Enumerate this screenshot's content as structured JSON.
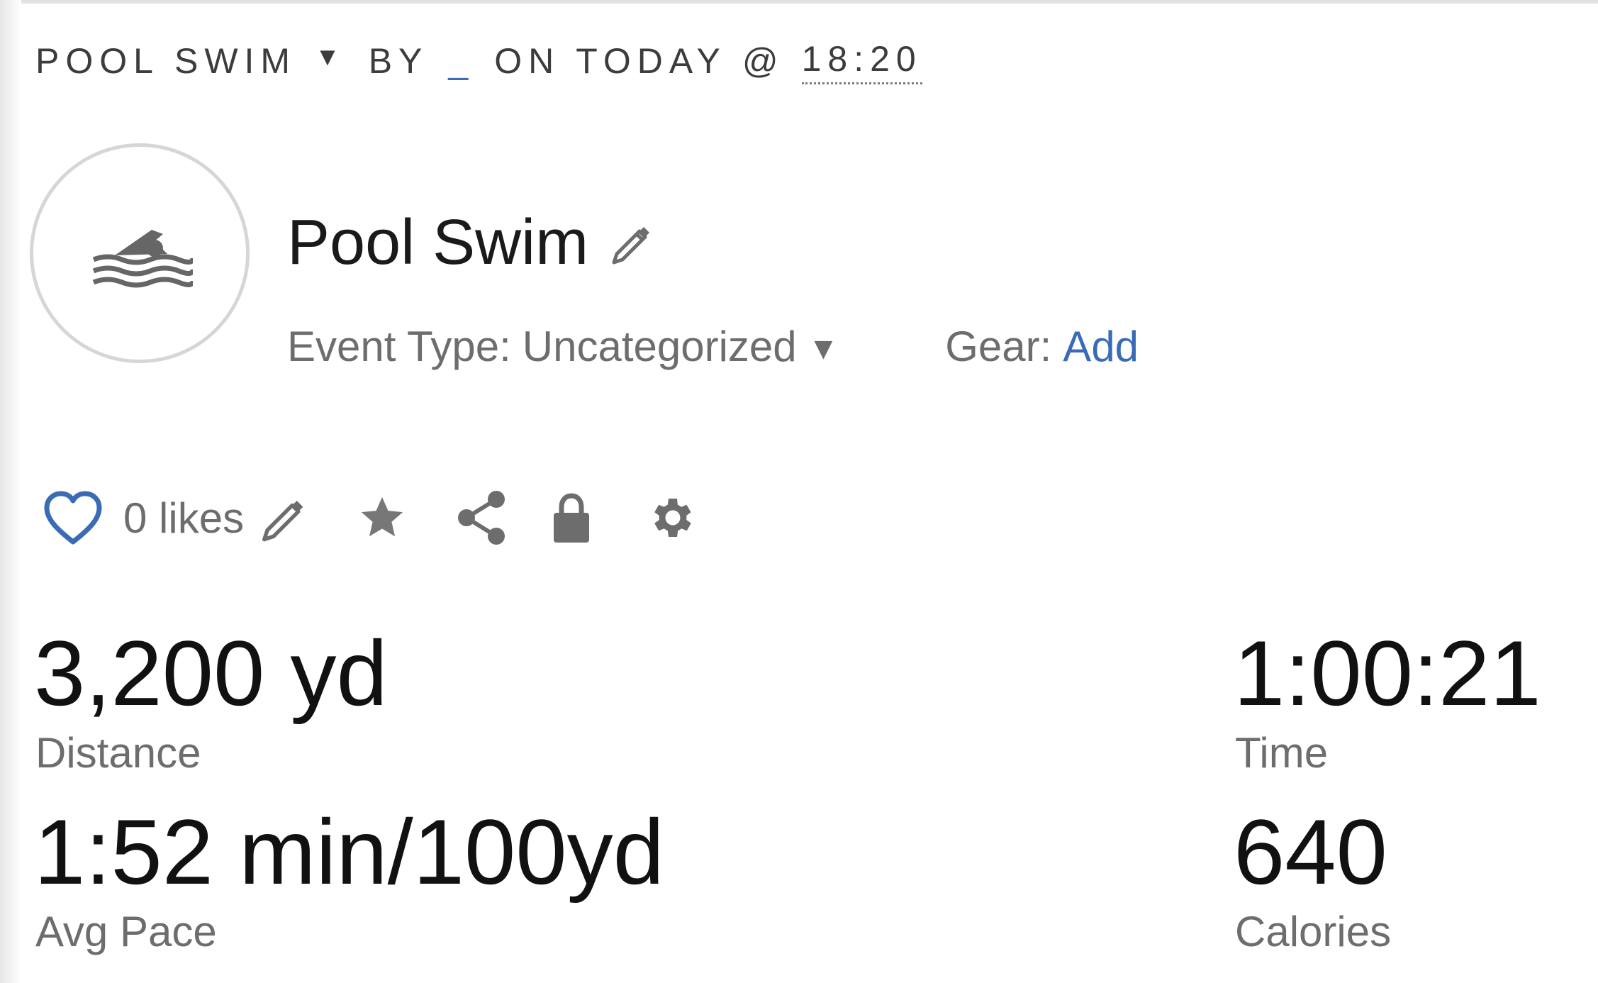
{
  "header": {
    "activity_type": "POOL SWIM",
    "caret": "▼",
    "by": "BY",
    "owner": "_",
    "on": "ON TODAY @",
    "time": "18:20"
  },
  "activity": {
    "icon": "swimmer-icon",
    "title": "Pool Swim",
    "event_type_label": "Event Type:",
    "event_type_value": "Uncategorized",
    "event_type_caret": "▼",
    "gear_label": "Gear:",
    "gear_add": "Add"
  },
  "actions": {
    "likes_text": "0 likes",
    "icons": [
      "heart-icon",
      "pencil-icon",
      "star-icon",
      "share-icon",
      "lock-icon",
      "gear-icon"
    ]
  },
  "stats": {
    "distance": {
      "value": "3,200 yd",
      "label": "Distance"
    },
    "time": {
      "value": "1:00:21",
      "label": "Time"
    },
    "avg_pace": {
      "value": "1:52 min/100yd",
      "label": "Avg Pace"
    },
    "calories": {
      "value": "640",
      "label": "Calories"
    }
  },
  "colors": {
    "link": "#3a6bb5",
    "heart": "#3a6bb5",
    "icon_gray": "#6d6d6d",
    "text_dark": "#111111"
  }
}
